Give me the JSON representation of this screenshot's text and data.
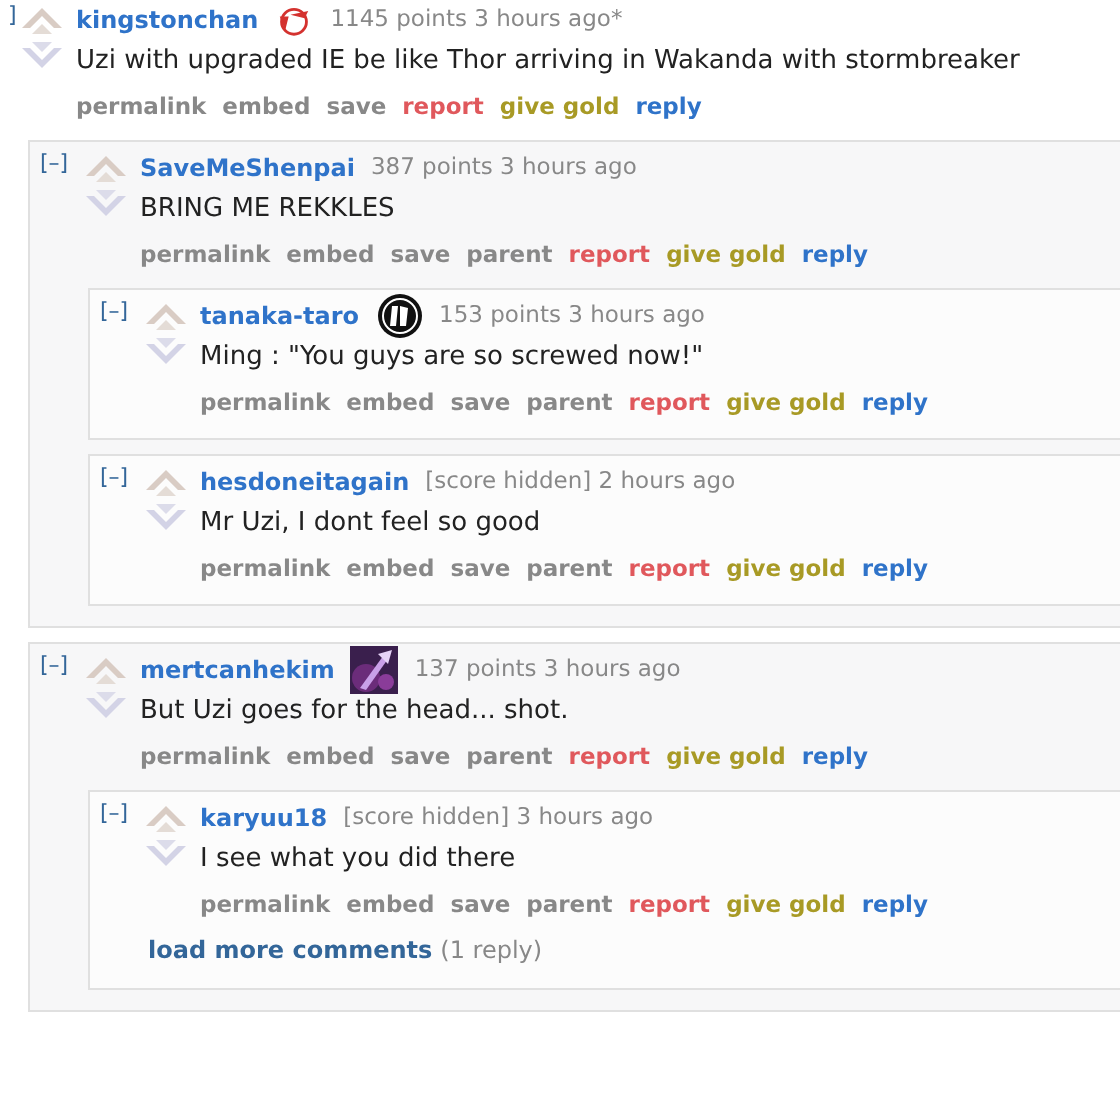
{
  "comments": [
    {
      "toggle": "]",
      "author": "kingstonchan",
      "flair": {
        "kind": "badge-100"
      },
      "tagline": "1145 points 3 hours ago*",
      "body": "Uzi with upgraded IE be like Thor arriving in Wakanda with stormbreaker",
      "links": [
        {
          "label": "permalink",
          "kind": "normal"
        },
        {
          "label": "embed",
          "kind": "normal"
        },
        {
          "label": "save",
          "kind": "normal"
        },
        {
          "label": "report",
          "kind": "report"
        },
        {
          "label": "give gold",
          "kind": "gold"
        },
        {
          "label": "reply",
          "kind": "reply"
        }
      ],
      "children": [
        {
          "toggle": "[–]",
          "author": "SaveMeShenpai",
          "tagline": "387 points 3 hours ago",
          "body": "BRING ME REKKLES",
          "links": [
            {
              "label": "permalink",
              "kind": "normal"
            },
            {
              "label": "embed",
              "kind": "normal"
            },
            {
              "label": "save",
              "kind": "normal"
            },
            {
              "label": "parent",
              "kind": "normal"
            },
            {
              "label": "report",
              "kind": "report"
            },
            {
              "label": "give gold",
              "kind": "gold"
            },
            {
              "label": "reply",
              "kind": "reply"
            }
          ],
          "children": [
            {
              "toggle": "[–]",
              "author": "tanaka-taro",
              "flair": {
                "kind": "badge-round"
              },
              "tagline": "153 points 3 hours ago",
              "body": "Ming : \"You guys are so screwed now!\"",
              "links": [
                {
                  "label": "permalink",
                  "kind": "normal"
                },
                {
                  "label": "embed",
                  "kind": "normal"
                },
                {
                  "label": "save",
                  "kind": "normal"
                },
                {
                  "label": "parent",
                  "kind": "normal"
                },
                {
                  "label": "report",
                  "kind": "report"
                },
                {
                  "label": "give gold",
                  "kind": "gold"
                },
                {
                  "label": "reply",
                  "kind": "reply"
                }
              ]
            },
            {
              "toggle": "[–]",
              "author": "hesdoneitagain",
              "tagline": "[score hidden] 2 hours ago",
              "body": "Mr Uzi, I dont feel so good",
              "links": [
                {
                  "label": "permalink",
                  "kind": "normal"
                },
                {
                  "label": "embed",
                  "kind": "normal"
                },
                {
                  "label": "save",
                  "kind": "normal"
                },
                {
                  "label": "parent",
                  "kind": "normal"
                },
                {
                  "label": "report",
                  "kind": "report"
                },
                {
                  "label": "give gold",
                  "kind": "gold"
                },
                {
                  "label": "reply",
                  "kind": "reply"
                }
              ]
            }
          ]
        },
        {
          "toggle": "[–]",
          "author": "mertcanhekim",
          "flair": {
            "kind": "picture"
          },
          "tagline": "137 points 3 hours ago",
          "body": "But Uzi goes for the head... shot.",
          "links": [
            {
              "label": "permalink",
              "kind": "normal"
            },
            {
              "label": "embed",
              "kind": "normal"
            },
            {
              "label": "save",
              "kind": "normal"
            },
            {
              "label": "parent",
              "kind": "normal"
            },
            {
              "label": "report",
              "kind": "report"
            },
            {
              "label": "give gold",
              "kind": "gold"
            },
            {
              "label": "reply",
              "kind": "reply"
            }
          ],
          "children": [
            {
              "toggle": "[–]",
              "author": "karyuu18",
              "tagline": "[score hidden] 3 hours ago",
              "body": "I see what you did there",
              "links": [
                {
                  "label": "permalink",
                  "kind": "normal"
                },
                {
                  "label": "embed",
                  "kind": "normal"
                },
                {
                  "label": "save",
                  "kind": "normal"
                },
                {
                  "label": "parent",
                  "kind": "normal"
                },
                {
                  "label": "report",
                  "kind": "report"
                },
                {
                  "label": "give gold",
                  "kind": "gold"
                },
                {
                  "label": "reply",
                  "kind": "reply"
                }
              ],
              "more": {
                "label": "load more comments",
                "count": "(1 reply)"
              }
            }
          ]
        }
      ]
    }
  ]
}
